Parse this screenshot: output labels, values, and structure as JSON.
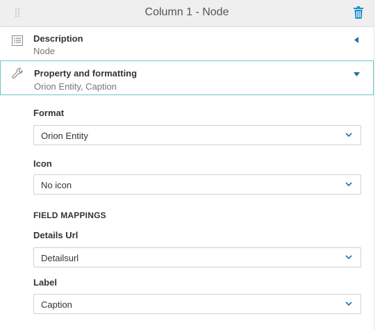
{
  "header": {
    "title": "Column 1 - Node",
    "accent": "#1e8bcf"
  },
  "sections": {
    "description": {
      "title": "Description",
      "subtitle": "Node",
      "icon": "list-icon",
      "state": "collapsed"
    },
    "property": {
      "title": "Property and formatting",
      "subtitle": "Orion Entity, Caption",
      "icon": "wrench-icon",
      "state": "expanded",
      "border_color": "#6cc7c9"
    }
  },
  "form": {
    "format": {
      "label": "Format",
      "value": "Orion Entity"
    },
    "icon": {
      "label": "Icon",
      "value": "No icon"
    },
    "field_mappings_heading": "FIELD MAPPINGS",
    "details_url": {
      "label": "Details Url",
      "value": "Detailsurl"
    },
    "label": {
      "label": "Label",
      "value": "Caption"
    }
  }
}
